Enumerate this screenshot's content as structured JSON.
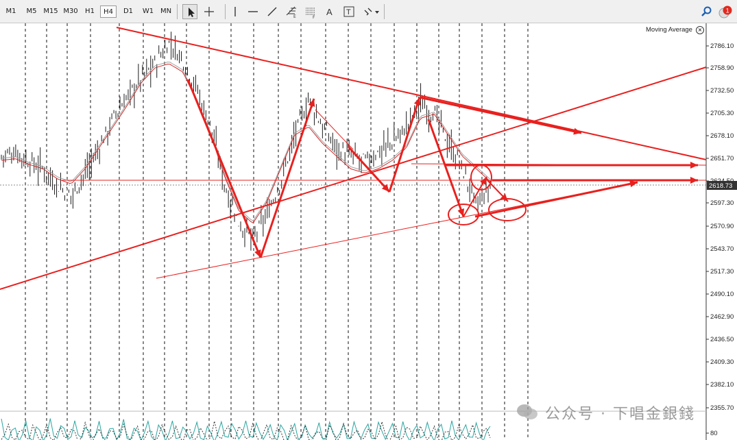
{
  "toolbar": {
    "timeframes": [
      "M1",
      "M5",
      "M15",
      "M30",
      "H1",
      "H4",
      "D1",
      "W1",
      "MN"
    ],
    "active_timeframe": "H4",
    "tools": [
      "cursor-icon",
      "crosshair-icon",
      "vertical-line-icon",
      "horizontal-line-icon",
      "trendline-icon",
      "fibonacci-icon",
      "fibonacci-channel-icon",
      "text-icon",
      "text-label-icon",
      "arrows-icon"
    ],
    "search_icon": "search-icon",
    "notification_count": "1"
  },
  "indicator": {
    "name": "Moving Average"
  },
  "current_price": "2618.73",
  "price_scale": {
    "labels": [
      "2786.10",
      "2758.90",
      "2732.50",
      "2705.30",
      "2678.10",
      "2651.70",
      "2624.50",
      "2597.30",
      "2570.90",
      "2543.70",
      "2517.30",
      "2490.10",
      "2462.90",
      "2436.50",
      "2409.30",
      "2382.10",
      "2355.70",
      "80"
    ]
  },
  "watermark": {
    "text": "公众号 · 下唱金銀錢"
  },
  "colors": {
    "annotation": "#e8201e",
    "bars": "#1a1a1a",
    "ma_line": "#cf2b2b",
    "ma_shadow": "#a0a0a0",
    "oscillator": "#2aa5a0",
    "grid": "#111111",
    "badge": "#e02a20",
    "price_box": "#333333"
  },
  "chart_data": {
    "type": "line",
    "title": "",
    "xlabel": "",
    "ylabel": "",
    "ylim": [
      2340,
      2800
    ],
    "series": [
      {
        "name": "Moving Average",
        "values": [
          2650,
          2652,
          2645,
          2640,
          2628,
          2622,
          2640,
          2665,
          2690,
          2715,
          2742,
          2760,
          2765,
          2755,
          2720,
          2680,
          2630,
          2590,
          2575,
          2600,
          2640,
          2680,
          2690,
          2670,
          2655,
          2640,
          2635,
          2640,
          2650,
          2665,
          2700,
          2705,
          2680,
          2655,
          2640,
          2625
        ]
      }
    ],
    "price_series": [
      2655,
      2660,
      2648,
      2640,
      2620,
      2608,
      2635,
      2665,
      2700,
      2725,
      2748,
      2765,
      2790,
      2770,
      2735,
      2690,
      2620,
      2575,
      2555,
      2585,
      2625,
      2680,
      2722,
      2690,
      2665,
      2655,
      2648,
      2660,
      2672,
      2690,
      2718,
      2705,
      2670,
      2640,
      2595,
      2618
    ]
  }
}
